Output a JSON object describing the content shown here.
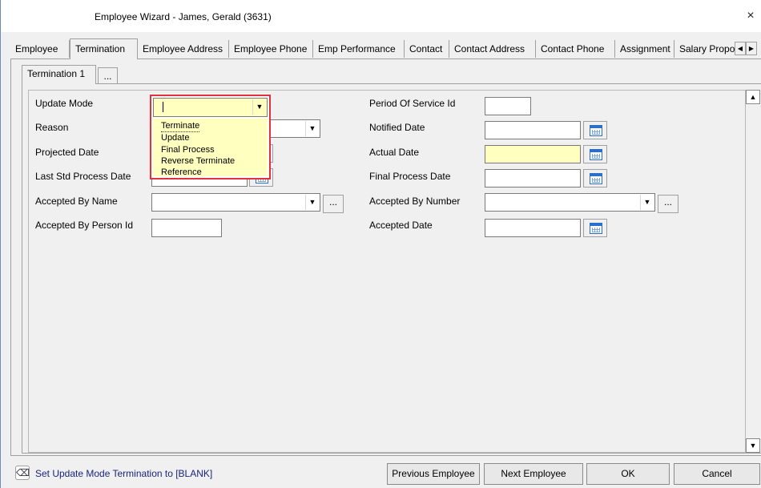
{
  "window": {
    "title": "Employee Wizard - James, Gerald (3631)",
    "close": "×"
  },
  "tabs": [
    {
      "label": "Employee"
    },
    {
      "label": "Termination"
    },
    {
      "label": "Employee Address"
    },
    {
      "label": "Employee Phone"
    },
    {
      "label": "Emp Performance"
    },
    {
      "label": "Contact"
    },
    {
      "label": "Contact Address"
    },
    {
      "label": "Contact Phone"
    },
    {
      "label": "Assignment"
    },
    {
      "label": "Salary Proposa"
    }
  ],
  "active_tab": "Termination",
  "tab_scroll": {
    "left": "◀",
    "right": "▶"
  },
  "subtabs": {
    "active": "Termination 1",
    "more": "..."
  },
  "form": {
    "update_mode_label": "Update Mode",
    "update_mode_value": "",
    "update_mode_options": [
      "Terminate",
      "Update",
      "Final Process",
      "Reverse Terminate",
      "Reference"
    ],
    "reason_label": "Reason",
    "projected_date_label": "Projected Date",
    "last_std_process_date_label": "Last Std Process Date",
    "accepted_by_name_label": "Accepted By Name",
    "accepted_by_person_id_label": "Accepted By Person Id",
    "period_of_service_id_label": "Period Of Service Id",
    "notified_date_label": "Notified Date",
    "actual_date_label": "Actual Date",
    "final_process_date_label": "Final Process Date",
    "accepted_by_number_label": "Accepted By Number",
    "accepted_date_label": "Accepted Date",
    "ellipsis": "...",
    "dropdown_arrow": "▼"
  },
  "scrollbar": {
    "up": "▲",
    "down": "▼"
  },
  "status": {
    "text": "Set Update Mode Termination to [BLANK]",
    "icon": "eraser-icon"
  },
  "buttons": {
    "previous_employee": "Previous Employee",
    "next_employee": "Next Employee",
    "ok": "OK",
    "cancel": "Cancel"
  },
  "colors": {
    "required_field": "#ffffc0",
    "highlight_border": "#e0323e",
    "status_text": "#1a237e"
  }
}
